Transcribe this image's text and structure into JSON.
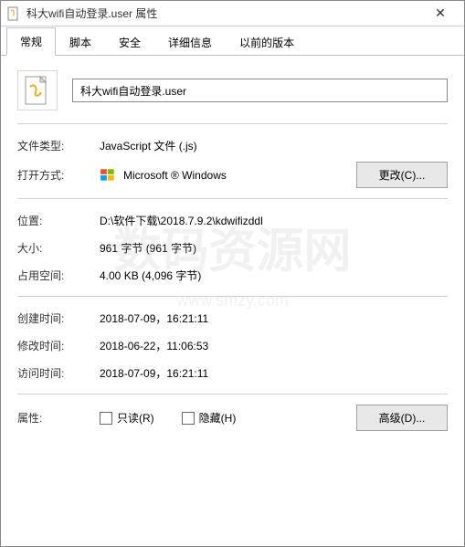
{
  "window": {
    "title": "科大wifi自动登录.user 属性"
  },
  "tabs": {
    "general": "常规",
    "script": "脚本",
    "security": "安全",
    "details": "详细信息",
    "previous": "以前的版本"
  },
  "filename": "科大wifi自动登录.user",
  "rows": {
    "filetype_label": "文件类型:",
    "filetype_value": "JavaScript 文件 (.js)",
    "openwith_label": "打开方式:",
    "openwith_value": "Microsoft ® Windows",
    "change_btn": "更改(C)...",
    "location_label": "位置:",
    "location_value": "D:\\软件下载\\2018.7.9.2\\kdwifizddl",
    "size_label": "大小:",
    "size_value": "961 字节 (961 字节)",
    "ondisk_label": "占用空间:",
    "ondisk_value": "4.00 KB (4,096 字节)",
    "created_label": "创建时间:",
    "created_value": "2018-07-09，16:21:11",
    "modified_label": "修改时间:",
    "modified_value": "2018-06-22，11:06:53",
    "accessed_label": "访问时间:",
    "accessed_value": "2018-07-09，16:21:11",
    "attr_label": "属性:",
    "readonly": "只读(R)",
    "hidden": "隐藏(H)",
    "advanced_btn": "高级(D)..."
  },
  "watermark": {
    "main": "数码资源网",
    "sub": "www.smzy.com"
  }
}
